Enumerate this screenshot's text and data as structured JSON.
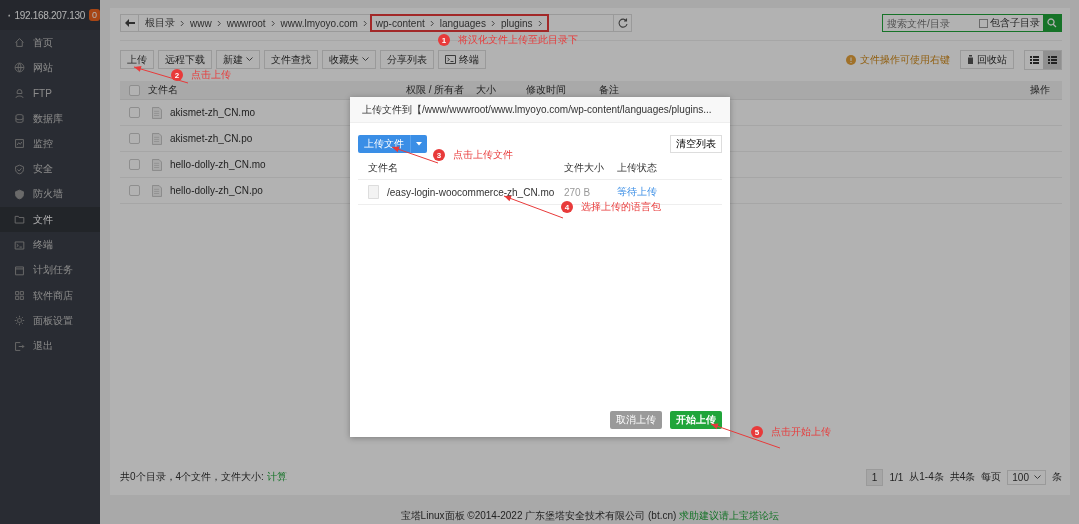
{
  "server": {
    "ip": "192.168.207.130",
    "badge": "0"
  },
  "sidebar": {
    "items": [
      {
        "label": "首页",
        "selected": false
      },
      {
        "label": "网站",
        "selected": false
      },
      {
        "label": "FTP",
        "selected": false
      },
      {
        "label": "数据库",
        "selected": false
      },
      {
        "label": "监控",
        "selected": false
      },
      {
        "label": "安全",
        "selected": false
      },
      {
        "label": "防火墙",
        "selected": false
      },
      {
        "label": "文件",
        "selected": true
      },
      {
        "label": "终端",
        "selected": false
      },
      {
        "label": "计划任务",
        "selected": false
      },
      {
        "label": "软件商店",
        "selected": false
      },
      {
        "label": "面板设置",
        "selected": false
      },
      {
        "label": "退出",
        "selected": false
      }
    ]
  },
  "breadcrumb": [
    "根目录",
    "www",
    "wwwroot",
    "www.lmyoyo.com",
    "wp-content",
    "languages",
    "plugins"
  ],
  "search": {
    "placeholder": "搜索文件/目录",
    "include_subdirs": {
      "label": "包含子目录",
      "checked": false
    }
  },
  "toolbar": [
    {
      "label": "上传",
      "dropdown": false,
      "has_icon": false
    },
    {
      "label": "远程下载",
      "dropdown": false,
      "has_icon": false
    },
    {
      "label": "新建",
      "dropdown": true,
      "has_icon": false
    },
    {
      "label": "文件查找",
      "dropdown": false,
      "has_icon": false
    },
    {
      "label": "收藏夹",
      "dropdown": true,
      "has_icon": false
    },
    {
      "label": "分享列表",
      "dropdown": false,
      "has_icon": false
    },
    {
      "label": "终端",
      "dropdown": false,
      "has_icon": true
    }
  ],
  "hint": "文件操作可使用右键",
  "recycle_bin": "回收站",
  "view_modes": [
    {
      "selected": false
    },
    {
      "selected": true
    }
  ],
  "table": {
    "select_all": {
      "checked": false
    },
    "columns": [
      "文件名",
      "权限 / 所有者",
      "大小",
      "修改时间",
      "备注",
      "操作"
    ],
    "rows": [
      {
        "name": "akismet-zh_CN.mo",
        "checked": false
      },
      {
        "name": "akismet-zh_CN.po",
        "checked": false
      },
      {
        "name": "hello-dolly-zh_CN.mo",
        "checked": false
      },
      {
        "name": "hello-dolly-zh_CN.po",
        "checked": false
      }
    ]
  },
  "summary": {
    "text": "共0个目录，4个文件，文件大小:",
    "link": "计算"
  },
  "pagination": {
    "current": "1",
    "pages": "1/1",
    "range": "从1-4条",
    "total": "共4条",
    "per_page_label": "每页",
    "per_page": "100",
    "unit": "条"
  },
  "page_footer": {
    "copyright": "宝塔Linux面板 ©2014-2022 广东堡塔安全技术有限公司 (bt.cn)",
    "link": "求助建议请上宝塔论坛"
  },
  "dialog": {
    "title": "上传文件到【/www/wwwroot/www.lmyoyo.com/wp-content/languages/plugins...",
    "upload_button": "上传文件",
    "clear_button": "清空列表",
    "columns": [
      "文件名",
      "文件大小",
      "上传状态"
    ],
    "files": [
      {
        "name": "/easy-login-woocommerce-zh_CN.mo",
        "size": "270 B",
        "status": "等待上传"
      }
    ],
    "cancel_button": "取消上传",
    "cancel_disabled": true,
    "start_button": "开始上传"
  },
  "annotations": [
    {
      "number": "1",
      "text": "将汉化文件上传至此目录下"
    },
    {
      "number": "2",
      "text": "点击上传"
    },
    {
      "number": "3",
      "text": "点击上传文件"
    },
    {
      "number": "4",
      "text": "选择上传的语言包"
    },
    {
      "number": "5",
      "text": "点击开始上传"
    }
  ]
}
